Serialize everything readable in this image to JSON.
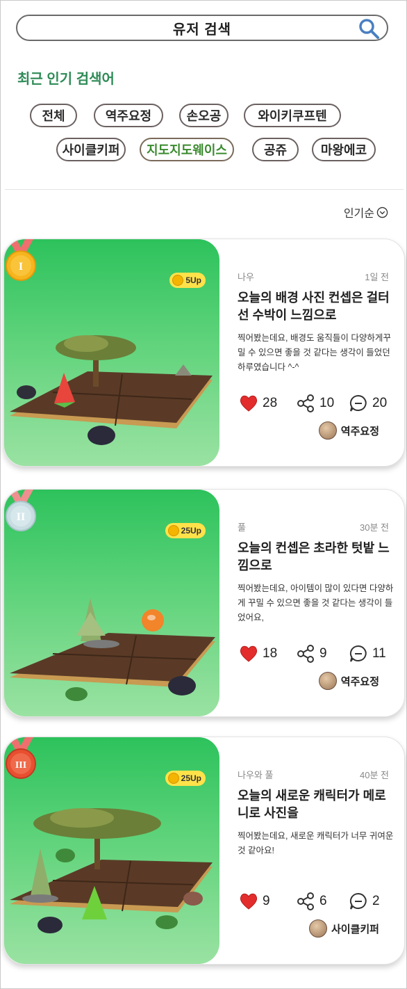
{
  "search": {
    "label": "유저 검색"
  },
  "popular": {
    "title": "최근 인기 검색어",
    "chips": [
      "전체",
      "역주요정",
      "손오공",
      "와이키쿠프텐",
      "사이클키퍼",
      "지도지도웨이스",
      "공쥬",
      "마왕에코"
    ],
    "active_chip": "지도지도웨이스"
  },
  "sort": {
    "label": "인기순"
  },
  "posts": [
    {
      "rank": "I",
      "medal": "gold",
      "coin": "5Up",
      "tag": "나우",
      "time": "1일 전",
      "title": "오늘의 배경 사진 컨셉은 걸터 선 수박이 느낌으로",
      "body": "찍어봤는데요, 배경도 움직들이 다양하게꾸밀 수 있으면 좋을 것 같다는 생각이 들었던 하루였습니다 ^-^",
      "likes": "28",
      "shares": "10",
      "comments": "20",
      "author": "역주요정"
    },
    {
      "rank": "II",
      "medal": "silver",
      "coin": "25Up",
      "tag": "풀",
      "time": "30분 전",
      "title": "오늘의 컨셉은 초라한 텃밭 느낌으로",
      "body": "찍어봤는데요, 아이템이 많이 있다면 다양하게 꾸밀 수 있으면 좋을 것 같다는 생각이 들었어요,",
      "likes": "18",
      "shares": "9",
      "comments": "11",
      "author": "역주요정"
    },
    {
      "rank": "III",
      "medal": "bronze",
      "coin": "25Up",
      "tag": "나우와 풀",
      "time": "40분 전",
      "title": "오늘의 새로운 캐릭터가 메로니로 사진을",
      "body": "찍어봤는데요, 새로운 캐릭터가 너무 귀여운 것 같아요!",
      "likes": "9",
      "shares": "6",
      "comments": "2",
      "author": "사이클키퍼"
    }
  ],
  "icons": {
    "search": "search-icon",
    "sort": "chevron-down-circle-icon",
    "like": "heart-icon",
    "share": "share-icon",
    "comment": "comment-icon"
  },
  "colors": {
    "accent_green": "#2e8b57",
    "heart_red": "#e32d2d",
    "thumb_green": "#3ecb68",
    "gold": "#f6b51e",
    "silver": "#c8dde2",
    "bronze": "#e84f31"
  }
}
